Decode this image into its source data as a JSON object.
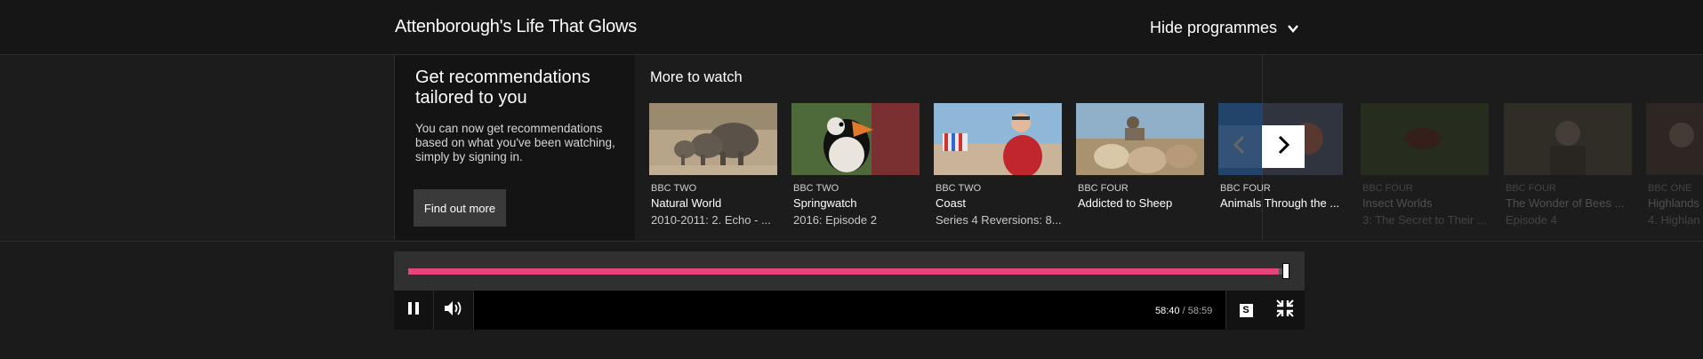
{
  "header": {
    "title": "Attenborough's Life That Glows",
    "hide_label": "Hide programmes"
  },
  "promo": {
    "title": "Get recommendations tailored to you",
    "body": "You can now get recommendations based on what you've been watching, simply by signing in.",
    "button_label": "Find out more"
  },
  "rail": {
    "title": "More to watch",
    "items": [
      {
        "channel": "BBC TWO",
        "name": "Natural World",
        "episode": "2010-2011: 2. Echo - ..."
      },
      {
        "channel": "BBC TWO",
        "name": "Springwatch",
        "episode": "2016: Episode 2"
      },
      {
        "channel": "BBC TWO",
        "name": "Coast",
        "episode": "Series 4 Reversions: 8..."
      },
      {
        "channel": "BBC FOUR",
        "name": "Addicted to Sheep",
        "episode": ""
      },
      {
        "channel": "BBC FOUR",
        "name": "Animals Through the ...",
        "episode": ""
      },
      {
        "channel": "BBC FOUR",
        "name": "Insect Worlds",
        "episode": "3: The Secret to Their ..."
      },
      {
        "channel": "BBC FOUR",
        "name": "The Wonder of Bees ...",
        "episode": "Episode 4"
      },
      {
        "channel": "BBC ONE",
        "name": "Highlands",
        "episode": "4. Highlan"
      }
    ]
  },
  "player": {
    "current_time": "58:40",
    "total_time": "/ 58:59",
    "progress_fraction": 0.995,
    "subtitles_label": "S",
    "accent_color": "#e8457d"
  }
}
